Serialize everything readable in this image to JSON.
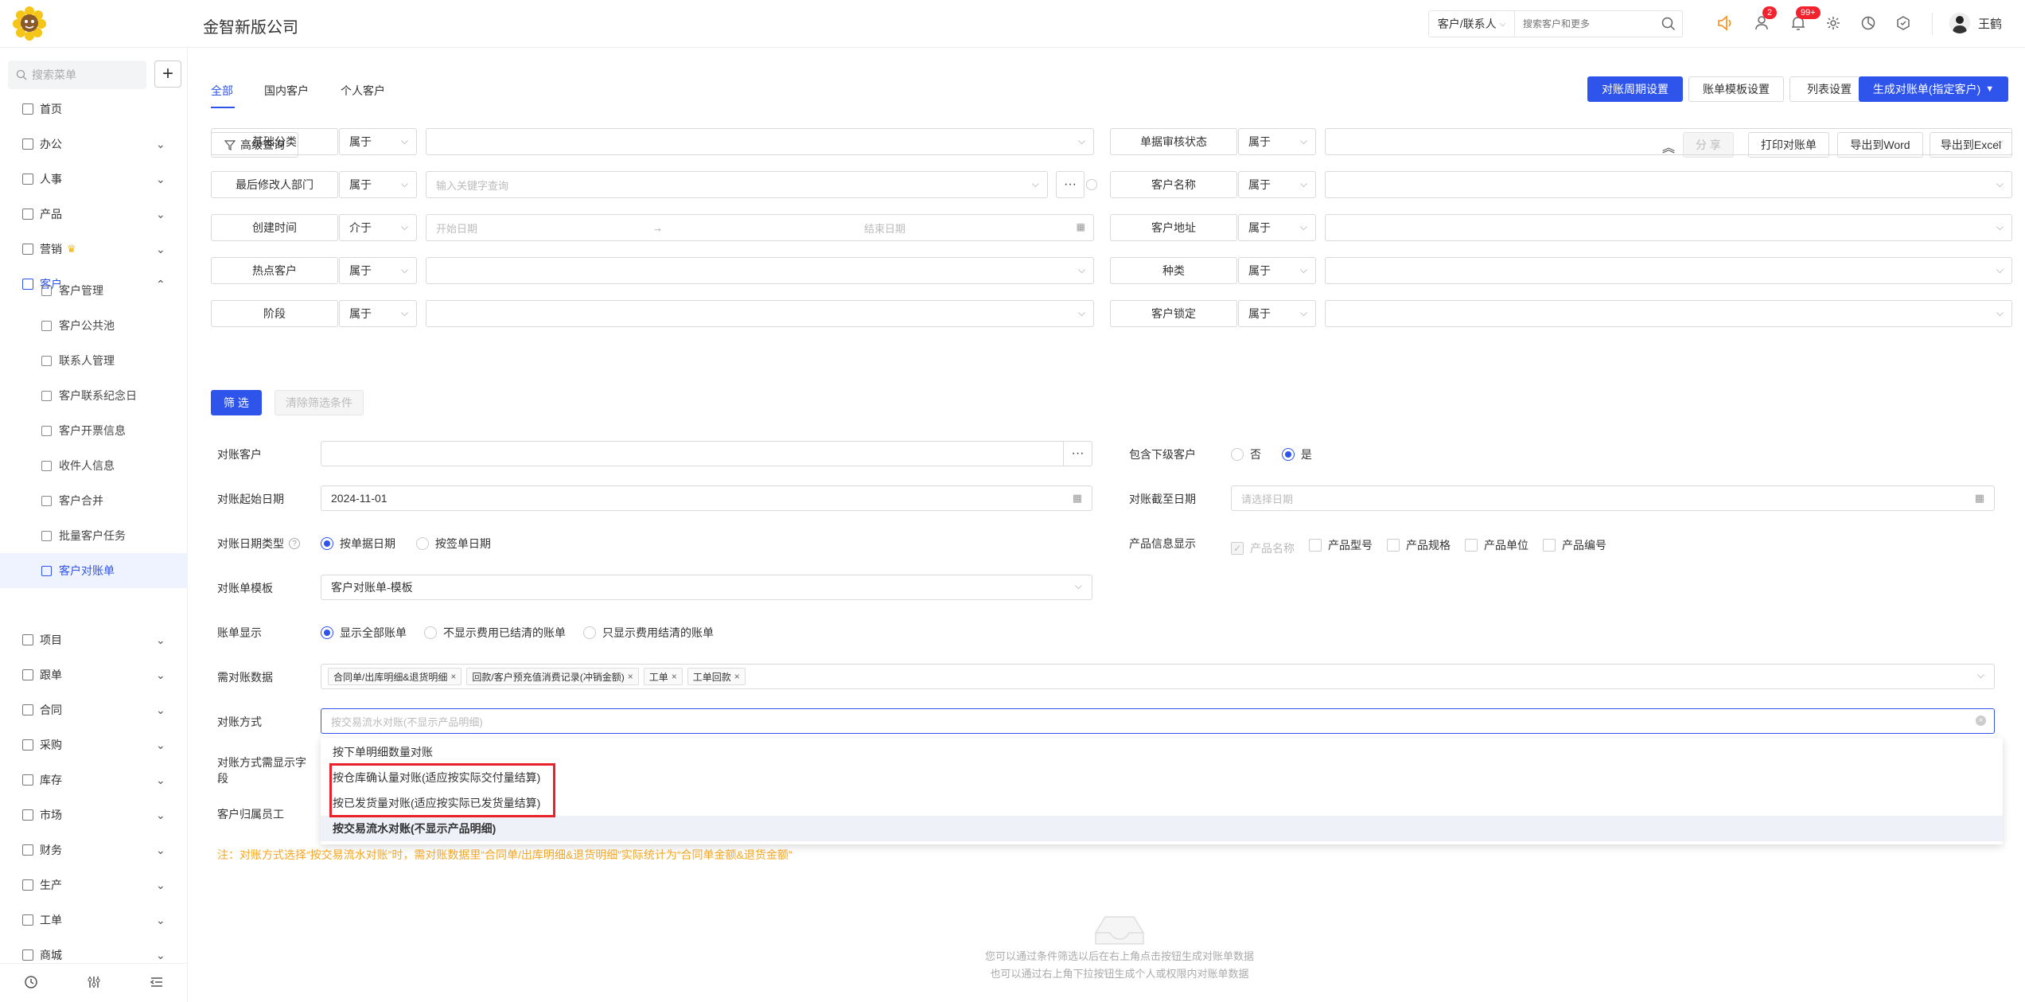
{
  "header": {
    "company": "金智新版公司",
    "search_select": "客户/联系人",
    "search_placeholder": "搜索客户和更多",
    "badge_users": "2",
    "badge_bell": "99+",
    "username": "王鹤",
    "brand_color": "#2f54eb"
  },
  "sidebar": {
    "search_placeholder": "搜索菜单",
    "items": [
      {
        "label": "首页",
        "icon": "home-icon"
      },
      {
        "label": "办公",
        "icon": "office-icon"
      },
      {
        "label": "人事",
        "icon": "people-icon"
      },
      {
        "label": "产品",
        "icon": "product-icon"
      },
      {
        "label": "营销",
        "icon": "marketing-icon"
      },
      {
        "label": "客户",
        "icon": "customer-icon"
      }
    ],
    "sub_items": [
      {
        "label": "客户管理"
      },
      {
        "label": "客户公共池"
      },
      {
        "label": "联系人管理"
      },
      {
        "label": "客户联系纪念日"
      },
      {
        "label": "客户开票信息"
      },
      {
        "label": "收件人信息"
      },
      {
        "label": "客户合并"
      },
      {
        "label": "批量客户任务"
      },
      {
        "label": "客户对账单"
      }
    ],
    "items2": [
      {
        "label": "项目"
      },
      {
        "label": "跟单"
      },
      {
        "label": "合同"
      },
      {
        "label": "采购"
      },
      {
        "label": "库存"
      },
      {
        "label": "市场"
      },
      {
        "label": "财务"
      },
      {
        "label": "生产"
      },
      {
        "label": "工单"
      },
      {
        "label": "商城"
      }
    ]
  },
  "tabs": [
    {
      "label": "全部"
    },
    {
      "label": "国内客户"
    },
    {
      "label": "个人客户"
    }
  ],
  "toolbar": {
    "period_setting": "对账周期设置",
    "template_setting": "账单模板设置",
    "list_setting": "列表设置",
    "generate": "生成对账单(指定客户)",
    "advanced_query": "高级查询",
    "share": "分 享",
    "print": "打印对账单",
    "export_word": "导出到Word",
    "export_excel": "导出到Excel"
  },
  "filters": {
    "left": [
      {
        "label": "基础分类",
        "op": "属于",
        "value": ""
      },
      {
        "label": "最后修改人部门",
        "op": "属于",
        "value": "输入关键字查询"
      },
      {
        "label": "创建时间",
        "op": "介于",
        "start": "开始日期",
        "end": "结束日期"
      },
      {
        "label": "热点客户",
        "op": "属于",
        "value": ""
      },
      {
        "label": "阶段",
        "op": "属于",
        "value": ""
      }
    ],
    "right": [
      {
        "label": "单据审核状态",
        "op": "属于"
      },
      {
        "label": "客户名称",
        "op": "属于"
      },
      {
        "label": "客户地址",
        "op": "属于"
      },
      {
        "label": "种类",
        "op": "属于"
      },
      {
        "label": "客户锁定",
        "op": "属于"
      }
    ],
    "filter_btn": "筛 选",
    "clear_btn": "清除筛选条件"
  },
  "form": {
    "customer_label": "对账客户",
    "include_sub_label": "包含下级客户",
    "include_sub_no": "否",
    "include_sub_yes": "是",
    "start_label": "对账起始日期",
    "start_value": "2024-11-01",
    "end_label": "对账截至日期",
    "end_placeholder": "请选择日期",
    "date_type_label": "对账日期类型",
    "date_type_opt1": "按单据日期",
    "date_type_opt2": "按签单日期",
    "product_info_label": "产品信息显示",
    "product_opts": [
      "产品名称",
      "产品型号",
      "产品规格",
      "产品单位",
      "产品编号"
    ],
    "template_label": "对账单模板",
    "template_value": "客户对账单-模板",
    "display_label": "账单显示",
    "display_opts": [
      "显示全部账单",
      "不显示费用已结清的账单",
      "只显示费用结清的账单"
    ],
    "data_label": "需对账数据",
    "data_tags": [
      "合同单/出库明细&退货明细",
      "回款/客户预充值消费记录(冲销金额)",
      "工单",
      "工单回款"
    ],
    "method_label": "对账方式",
    "method_placeholder": "按交易流水对账(不显示产品明细)",
    "method_fields_label": "对账方式需显示字段",
    "owner_label": "客户归属员工",
    "dropdown_options": [
      "按下单明细数量对账",
      "按仓库确认量对账(适应按实际交付量结算)",
      "按已发货量对账(适应按实际已发货量结算)",
      "按交易流水对账(不显示产品明细)"
    ],
    "note": "注：对账方式选择“按交易流水对账”时，需对账数据里“合同单/出库明细&退货明细”实际统计为“合同单金额&退货金额”"
  },
  "empty": {
    "line1": "您可以通过条件筛选以后在右上角点击按钮生成对账单数据",
    "line2": "也可以通过右上角下拉按钮生成个人或权限内对账单数据"
  }
}
